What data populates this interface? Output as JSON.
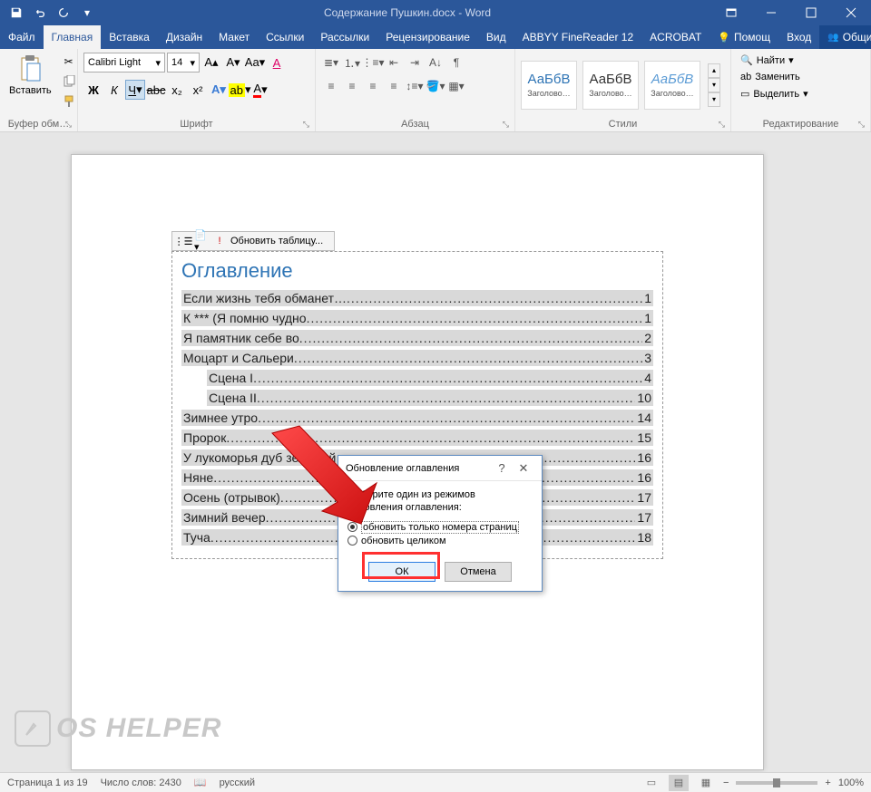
{
  "titlebar": {
    "title": "Содержание Пушкин.docx - Word"
  },
  "tabs": {
    "file": "Файл",
    "home": "Главная",
    "insert": "Вставка",
    "design": "Дизайн",
    "layout": "Макет",
    "refs": "Ссылки",
    "mail": "Рассылки",
    "review": "Рецензирование",
    "view": "Вид",
    "abbyy": "ABBYY FineReader 12",
    "acrobat": "ACROBAT",
    "tellme": "Помощ",
    "signin": "Вход",
    "share": "Общий доступ"
  },
  "ribbon": {
    "clipboard": {
      "paste": "Вставить",
      "label": "Буфер обм…"
    },
    "font": {
      "name": "Calibri Light",
      "size": "14",
      "label": "Шрифт"
    },
    "paragraph": {
      "label": "Абзац"
    },
    "styles": {
      "label": "Стили",
      "sample": "АаБбВ",
      "s1": "Заголово…",
      "s2": "Заголово…",
      "s3": "Заголово…"
    },
    "editing": {
      "find": "Найти",
      "replace": "Заменить",
      "select": "Выделить",
      "label": "Редактирование"
    }
  },
  "toc": {
    "toolbar_update": "Обновить таблицу...",
    "title": "Оглавление",
    "items": [
      {
        "text": "Если жизнь тебя обманет… ",
        "page": "1",
        "indent": false
      },
      {
        "text": "К *** (Я помню чудно",
        "page": "1",
        "indent": false
      },
      {
        "text": "Я памятник себе во",
        "page": "2",
        "indent": false
      },
      {
        "text": "Моцарт и Сальери ",
        "page": "3",
        "indent": false
      },
      {
        "text": "Сцена I ",
        "page": "4",
        "indent": true
      },
      {
        "text": "Сцена II ",
        "page": "10",
        "indent": true
      },
      {
        "text": "Зимнее утро ",
        "page": "14",
        "indent": false
      },
      {
        "text": "Пророк",
        "page": "15",
        "indent": false
      },
      {
        "text": "У лукоморья дуб зеленый… ",
        "page": "16",
        "indent": false
      },
      {
        "text": "Няне ",
        "page": "16",
        "indent": false
      },
      {
        "text": "Осень (отрывок) ",
        "page": "17",
        "indent": false
      },
      {
        "text": "Зимний вечер ",
        "page": "17",
        "indent": false
      },
      {
        "text": "Туча ",
        "page": "18",
        "indent": false
      }
    ]
  },
  "dialog": {
    "title": "Обновление оглавления",
    "msg": "Выберите один из режимов обновления оглавления:",
    "opt1": "обновить только номера страниц",
    "opt2": "обновить целиком",
    "ok": "ОК",
    "cancel": "Отмена"
  },
  "status": {
    "page": "Страница 1 из 19",
    "words": "Число слов: 2430",
    "lang": "русский",
    "zoom": "100%"
  },
  "watermark": "OS HELPER"
}
